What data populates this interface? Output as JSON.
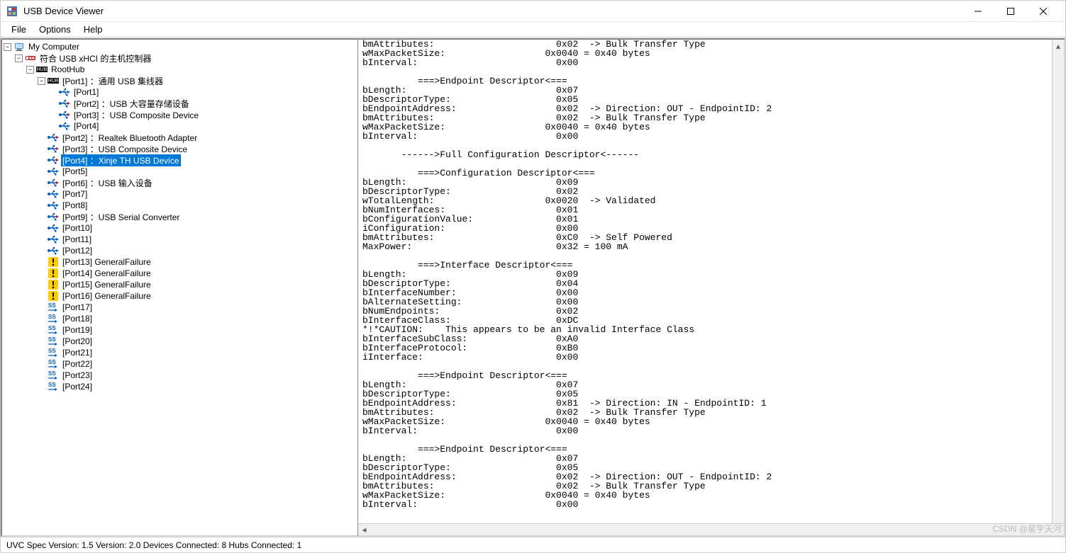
{
  "window_title": "USB Device Viewer",
  "menu": {
    "file": "File",
    "options": "Options",
    "help": "Help"
  },
  "statusbar": {
    "left": "UVC Spec Version: 1.5 Version: 2.0 Devices Connected: 8   Hubs Connected: 1",
    "right": "CSDN @星宇天河"
  },
  "tree": {
    "root": "My Computer",
    "hc": "符合 USB xHCI 的主机控制器",
    "roothub": "RootHub",
    "p1_hub": "[Port1] ：通用 USB 集线器",
    "p1_1": "[Port1]",
    "p1_2": "[Port2] ：USB 大容量存储设备",
    "p1_3": "[Port3] ：USB Composite Device",
    "p1_4": "[Port4]",
    "p2": "[Port2] ：Realtek Bluetooth Adapter",
    "p3": "[Port3] ：USB Composite Device",
    "p4": "[Port4] ：Xinje TH USB Device",
    "p5": "[Port5]",
    "p6": "[Port6] ：USB 输入设备",
    "p7": "[Port7]",
    "p8": "[Port8]",
    "p9": "[Port9] ：USB Serial Converter",
    "p10": "[Port10]",
    "p11": "[Port11]",
    "p12": "[Port12]",
    "p13": "[Port13] GeneralFailure",
    "p14": "[Port14] GeneralFailure",
    "p15": "[Port15] GeneralFailure",
    "p16": "[Port16] GeneralFailure",
    "p17": "[Port17]",
    "p18": "[Port18]",
    "p19": "[Port19]",
    "p20": "[Port20]",
    "p21": "[Port21]",
    "p22": "[Port22]",
    "p23": "[Port23]",
    "p24": "[Port24]"
  },
  "details": {
    "lines": [
      "bmAttributes:                      0x02  -> Bulk Transfer Type",
      "wMaxPacketSize:                  0x0040 = 0x40 bytes",
      "bInterval:                         0x00",
      "",
      "          ===>Endpoint Descriptor<===",
      "bLength:                           0x07",
      "bDescriptorType:                   0x05",
      "bEndpointAddress:                  0x02  -> Direction: OUT - EndpointID: 2",
      "bmAttributes:                      0x02  -> Bulk Transfer Type",
      "wMaxPacketSize:                  0x0040 = 0x40 bytes",
      "bInterval:                         0x00",
      "",
      "       ------>Full Configuration Descriptor<------",
      "",
      "          ===>Configuration Descriptor<===",
      "bLength:                           0x09",
      "bDescriptorType:                   0x02",
      "wTotalLength:                    0x0020  -> Validated",
      "bNumInterfaces:                    0x01",
      "bConfigurationValue:               0x01",
      "iConfiguration:                    0x00",
      "bmAttributes:                      0xC0  -> Self Powered",
      "MaxPower:                          0x32 = 100 mA",
      "",
      "          ===>Interface Descriptor<===",
      "bLength:                           0x09",
      "bDescriptorType:                   0x04",
      "bInterfaceNumber:                  0x00",
      "bAlternateSetting:                 0x00",
      "bNumEndpoints:                     0x02",
      "bInterfaceClass:                   0xDC",
      "*!*CAUTION:    This appears to be an invalid Interface Class",
      "bInterfaceSubClass:                0xA0",
      "bInterfaceProtocol:                0xB0",
      "iInterface:                        0x00",
      "",
      "          ===>Endpoint Descriptor<===",
      "bLength:                           0x07",
      "bDescriptorType:                   0x05",
      "bEndpointAddress:                  0x81  -> Direction: IN - EndpointID: 1",
      "bmAttributes:                      0x02  -> Bulk Transfer Type",
      "wMaxPacketSize:                  0x0040 = 0x40 bytes",
      "bInterval:                         0x00",
      "",
      "          ===>Endpoint Descriptor<===",
      "bLength:                           0x07",
      "bDescriptorType:                   0x05",
      "bEndpointAddress:                  0x02  -> Direction: OUT - EndpointID: 2",
      "bmAttributes:                      0x02  -> Bulk Transfer Type",
      "wMaxPacketSize:                  0x0040 = 0x40 bytes",
      "bInterval:                         0x00"
    ]
  }
}
